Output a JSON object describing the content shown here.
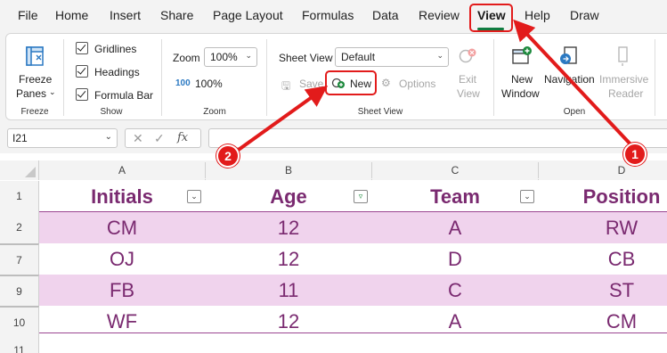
{
  "menu": {
    "items": [
      "File",
      "Home",
      "Insert",
      "Share",
      "Page Layout",
      "Formulas",
      "Data",
      "Review",
      "View",
      "Help",
      "Draw"
    ],
    "active": "View"
  },
  "ribbon": {
    "freeze": {
      "line1": "Freeze",
      "line2": "Panes",
      "group_label": "Freeze"
    },
    "show": {
      "gridlines": "Gridlines",
      "headings": "Headings",
      "formula_bar": "Formula Bar",
      "group_label": "Show"
    },
    "zoom": {
      "label": "Zoom",
      "value": "100%",
      "hundred_button": "100%",
      "group_label": "Zoom"
    },
    "sheet_view": {
      "label": "Sheet View",
      "selected": "Default",
      "save": "Save",
      "new": "New",
      "options": "Options",
      "exit_line1": "Exit",
      "exit_line2": "View",
      "group_label": "Sheet View"
    },
    "open": {
      "new_window_line1": "New",
      "new_window_line2": "Window",
      "navigation": "Navigation",
      "immersive_line1": "Immersive",
      "immersive_line2": "Reader",
      "group_label": "Open"
    }
  },
  "formula_bar": {
    "name_box": "I21",
    "fx": "fx"
  },
  "grid": {
    "columns": [
      "A",
      "B",
      "C",
      "D"
    ],
    "rows": [
      {
        "num": "1",
        "cells": [
          "Initials",
          "Age",
          "Team",
          "Position"
        ],
        "header": true
      },
      {
        "num": "2",
        "cells": [
          "CM",
          "12",
          "A",
          "RW"
        ]
      },
      {
        "num": "7",
        "cells": [
          "OJ",
          "12",
          "D",
          "CB"
        ]
      },
      {
        "num": "9",
        "cells": [
          "FB",
          "11",
          "C",
          "ST"
        ]
      },
      {
        "num": "10",
        "cells": [
          "WF",
          "12",
          "A",
          "CM"
        ]
      },
      {
        "num": "11",
        "cells": [
          "",
          "",
          "",
          ""
        ]
      }
    ]
  },
  "annotations": {
    "badge1": "1",
    "badge2": "2",
    "color": "#e21b1b"
  },
  "colors": {
    "table_text": "#7a2a70",
    "band": "#f0d3ed",
    "accent": "#107c41"
  }
}
